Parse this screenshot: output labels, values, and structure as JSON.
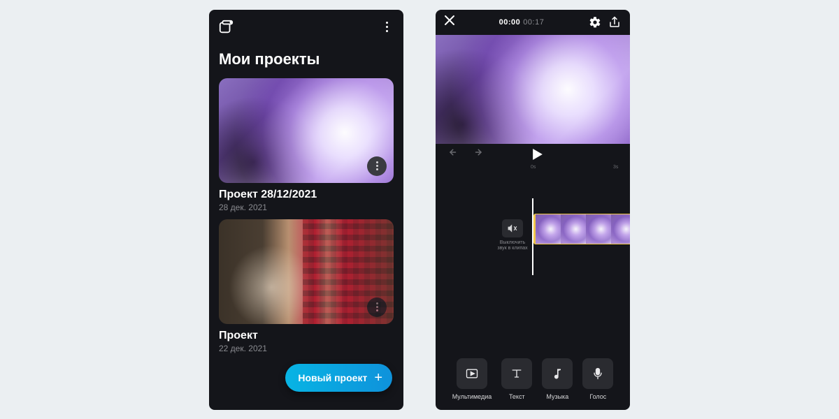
{
  "left": {
    "title": "Мои проекты",
    "projects": [
      {
        "name": "Проект 28/12/2021",
        "date": "28 дек. 2021"
      },
      {
        "name": "Проект",
        "date": "22 дек. 2021"
      }
    ],
    "fab_label": "Новый проект"
  },
  "right": {
    "time_current": "00:00",
    "time_total": "00:17",
    "ruler": {
      "t0": "0s",
      "t3": "3s"
    },
    "mute_label": "Выключить звук в клипах",
    "tools": [
      {
        "key": "media",
        "label": "Мультимедиа"
      },
      {
        "key": "text",
        "label": "Текст"
      },
      {
        "key": "music",
        "label": "Музыка"
      },
      {
        "key": "voice",
        "label": "Голос"
      }
    ]
  }
}
